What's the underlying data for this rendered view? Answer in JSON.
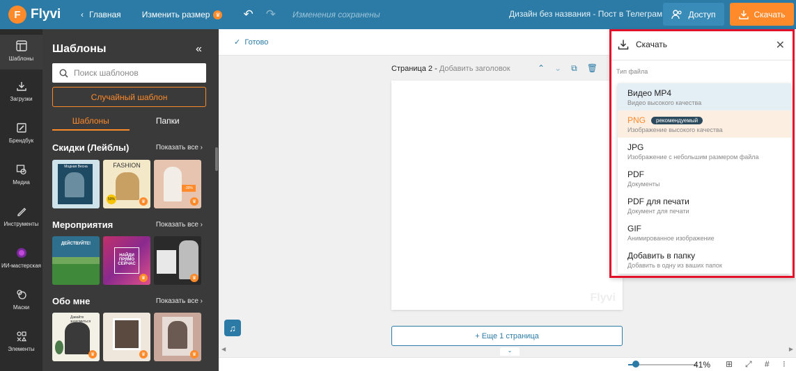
{
  "topbar": {
    "logo": "Flyvi",
    "home": "Главная",
    "resize": "Изменить размер",
    "saved": "Изменения сохранены",
    "design_title": "Дизайн без названия - Пост в Телеграм ...",
    "access": "Доступ",
    "download": "Скачать"
  },
  "rail": [
    {
      "label": "Шаблоны",
      "icon": "templates-icon"
    },
    {
      "label": "Загрузки",
      "icon": "upload-icon"
    },
    {
      "label": "Брендбук",
      "icon": "brandbook-icon"
    },
    {
      "label": "Медиа",
      "icon": "media-icon"
    },
    {
      "label": "Инструменты",
      "icon": "tools-icon"
    },
    {
      "label": "ИИ-мастерская",
      "icon": "ai-workshop-icon"
    },
    {
      "label": "Маски",
      "icon": "masks-icon"
    },
    {
      "label": "Элементы",
      "icon": "elements-icon"
    }
  ],
  "panel": {
    "title": "Шаблоны",
    "search_placeholder": "Поиск шаблонов",
    "random": "Случайный шаблон",
    "tabs": [
      "Шаблоны",
      "Папки"
    ],
    "sections": [
      {
        "title": "Скидки (Лейблы)",
        "show_all": "Показать все"
      },
      {
        "title": "Мероприятия",
        "show_all": "Показать все"
      },
      {
        "title": "Обо мне",
        "show_all": "Показать все"
      }
    ],
    "thumb_texts": {
      "s1t1": "Модная Весна",
      "s1t2": "FASHION",
      "s1t2b": "50%",
      "s1t3": "-30%",
      "s2t1": "ДЕЙСТВУЙТЕ!",
      "s2t2": "НАЙДИ ПРЯМО СЕЙЧАС",
      "s3t1": "Давайте знакомиться"
    }
  },
  "canvas": {
    "done": "Готово",
    "page_label": "Страница 2",
    "page_sub": "Добавить заголовок",
    "watermark": "Flyvi",
    "add_page": "+ Еще 1 страница"
  },
  "bottombar": {
    "zoom": "41%",
    "zoom_level": 0.41
  },
  "download_panel": {
    "title": "Скачать",
    "file_type_label": "Тип файла",
    "options": [
      {
        "name": "Видео MP4",
        "desc": "Видео высокого качества",
        "badge": ""
      },
      {
        "name": "PNG",
        "desc": "Изображение высокого качества",
        "badge": "рекомендуемый"
      },
      {
        "name": "JPG",
        "desc": "Изображение с небольшим размером файла",
        "badge": ""
      },
      {
        "name": "PDF",
        "desc": "Документы",
        "badge": ""
      },
      {
        "name": "PDF для печати",
        "desc": "Документ для печати",
        "badge": ""
      },
      {
        "name": "GIF",
        "desc": "Анимированное изображение",
        "badge": ""
      },
      {
        "name": "Добавить в папку",
        "desc": "Добавить в одну из ваших папок",
        "badge": ""
      }
    ]
  },
  "colors": {
    "topbar": "#2b7ba6",
    "accent": "#ff8a2a",
    "panel": "#3a3a3a",
    "rail": "#2b2b2b",
    "highlight": "#e3102a"
  }
}
